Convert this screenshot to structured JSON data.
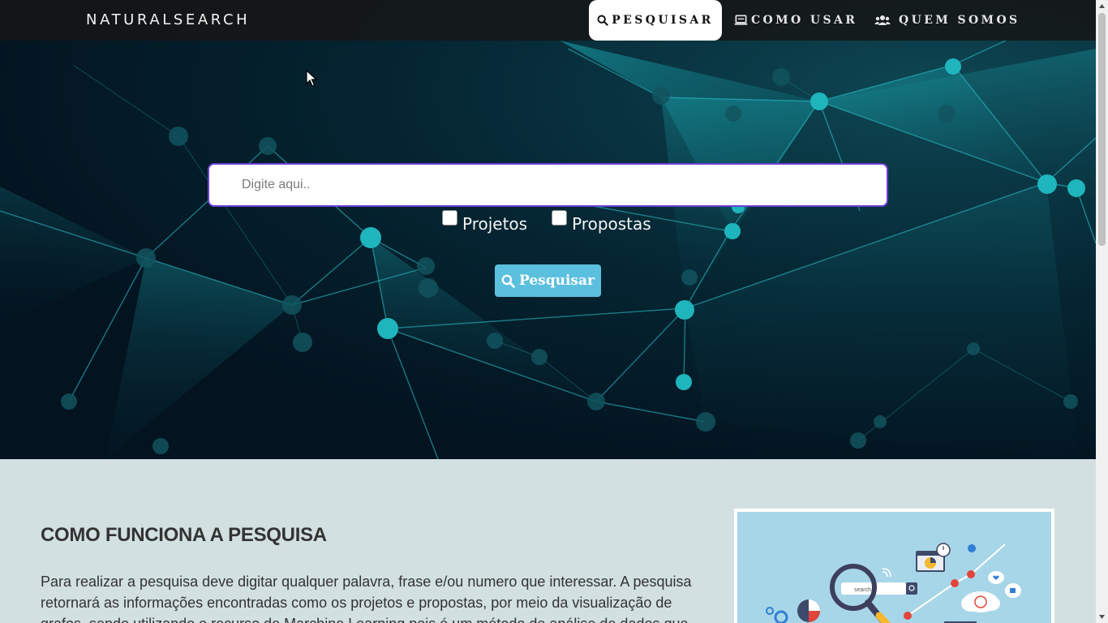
{
  "navbar": {
    "brand": "NATURALSEARCH",
    "items": [
      {
        "label": "PESQUISAR",
        "icon": "search-icon",
        "active": true
      },
      {
        "label": "COMO USAR",
        "icon": "laptop-icon",
        "active": false
      },
      {
        "label": "QUEM SOMOS",
        "icon": "users-icon",
        "active": false
      }
    ]
  },
  "hero": {
    "search_placeholder": "Digite aqui..",
    "search_value": "",
    "checkboxes": [
      {
        "label": "Projetos",
        "checked": false
      },
      {
        "label": "Propostas",
        "checked": false
      }
    ],
    "button_label": "Pesquisar",
    "button_icon": "search-icon"
  },
  "content": {
    "title": "COMO FUNCIONA A PESQUISA",
    "text": "Para realizar a pesquisa deve digitar qualquer palavra, frase e/ou numero que interessar. A pesquisa retornará as informações encontradas como os projetos e propostas, por meio da visualização de grafos, sendo utilizando o recurso de Marchine Learning pois é um método de análise de dados que",
    "illustration_search_text": "search..."
  },
  "colors": {
    "navbar_bg": "#1c1c1c",
    "hero_bg": "#031320",
    "accent_teal": "#1fb5bd",
    "button_bg": "#5bc0de",
    "content_bg": "#d2e0e1",
    "search_border": "#6a3fd4"
  }
}
